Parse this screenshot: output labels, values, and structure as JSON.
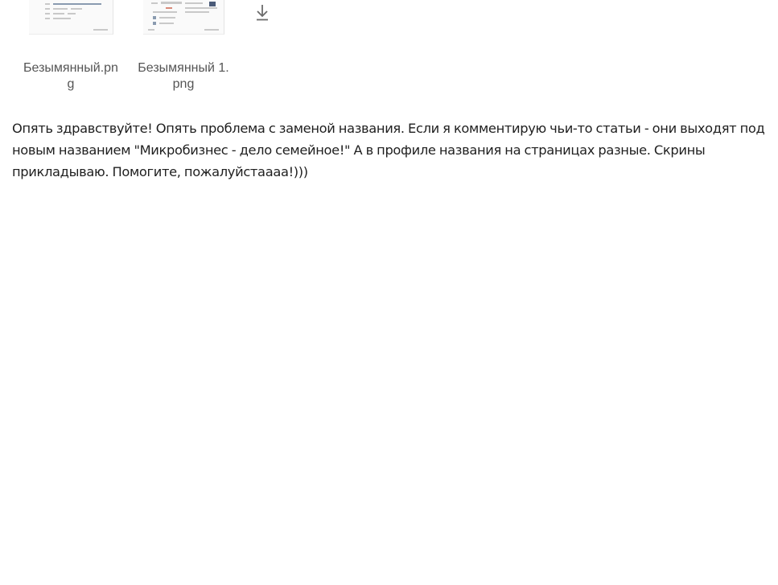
{
  "attachments": [
    {
      "file_name": "Безымянный.png"
    },
    {
      "file_name": "Безымянный 1.png"
    }
  ],
  "download_icon": "download-icon",
  "message": {
    "text": "Опять здравствуйте! Опять проблема с заменой названия. Если я комментирую чьи-то статьи - они выходят под новым названием \"Микробизнес - дело семейное!\" А в профиле названия на страницах разные. Скрины прикладываю. Помогите, пожалуйстаааа!)))"
  }
}
